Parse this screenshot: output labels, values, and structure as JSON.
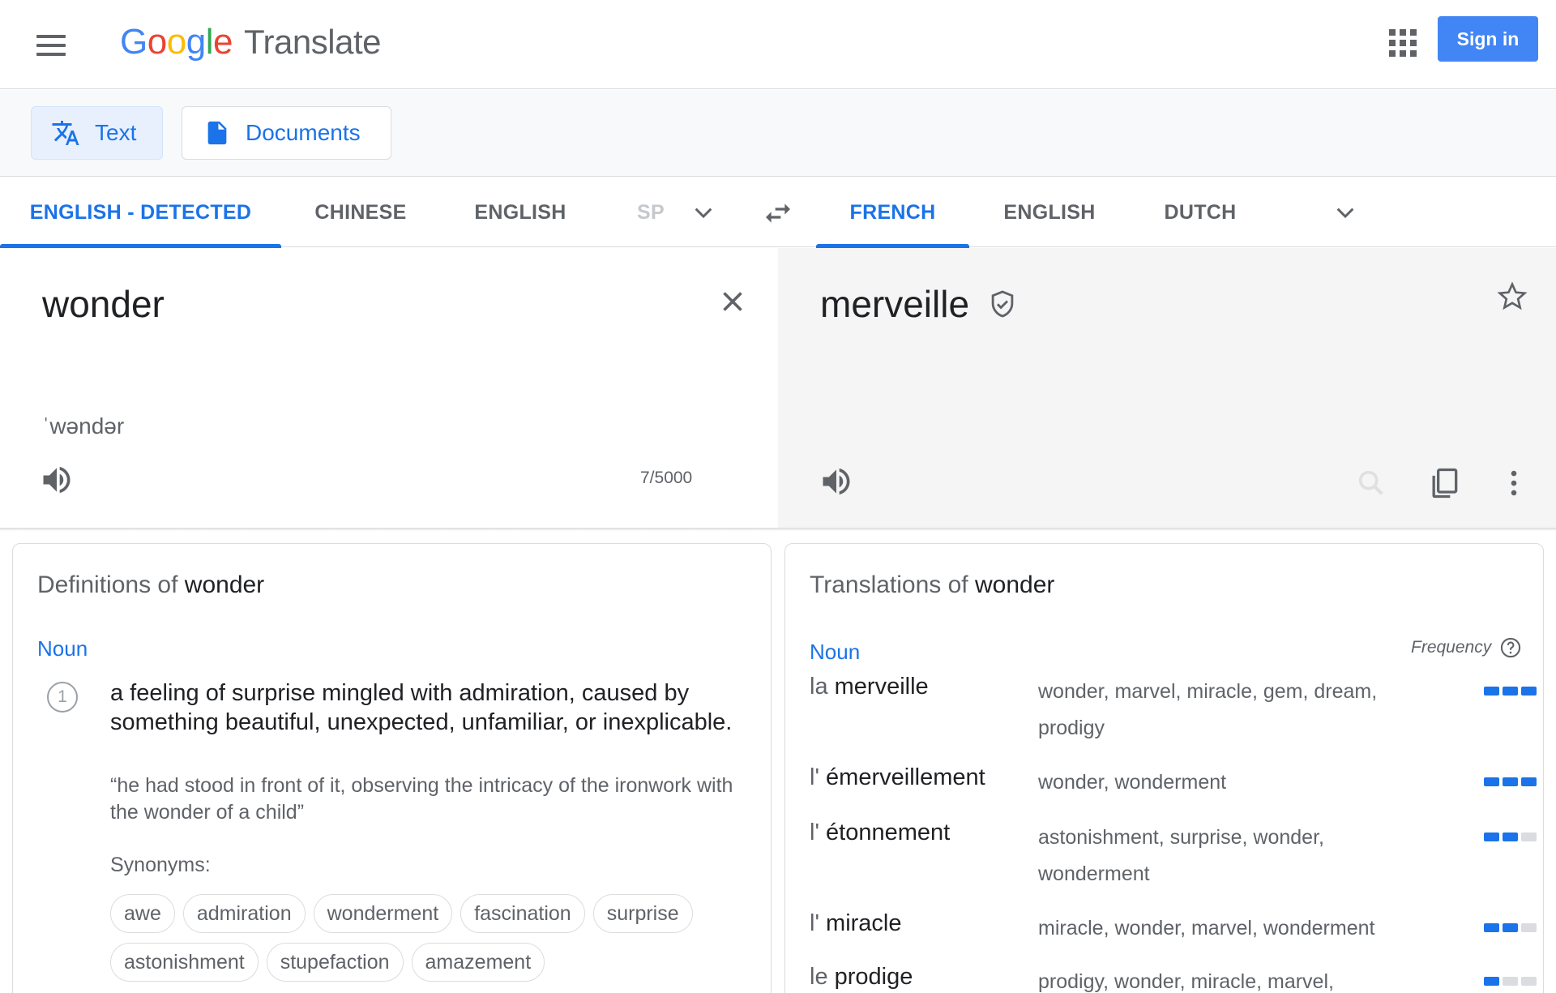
{
  "header": {
    "logo_letters": [
      "G",
      "o",
      "o",
      "g",
      "l",
      "e"
    ],
    "product": "Translate",
    "signin_label": "Sign in"
  },
  "modes": {
    "text_label": "Text",
    "documents_label": "Documents"
  },
  "source_langs": [
    "ENGLISH - DETECTED",
    "CHINESE",
    "ENGLISH",
    "SP"
  ],
  "target_langs": [
    "FRENCH",
    "ENGLISH",
    "DUTCH"
  ],
  "source": {
    "text": "wonder",
    "phonetic": "ˈwəndər",
    "char_count": "7/5000"
  },
  "target": {
    "text": "merveille"
  },
  "definitions": {
    "title_prefix": "Definitions of",
    "word": "wonder",
    "pos": "Noun",
    "number": "1",
    "text": "a feeling of surprise mingled with admiration, caused by something beautiful, unexpected, unfamiliar, or inexplicable.",
    "example": "“he had stood in front of it, observing the intricacy of the ironwork with the wonder of a child”",
    "synonyms_label": "Synonyms:",
    "synonyms_row1": [
      "awe",
      "admiration",
      "wonderment",
      "fascination",
      "surprise"
    ],
    "synonyms_row2": [
      "astonishment",
      "stupefaction",
      "amazement"
    ]
  },
  "translations": {
    "title_prefix": "Translations of",
    "word": "wonder",
    "pos": "Noun",
    "frequency_label": "Frequency",
    "rows": [
      {
        "article": "la",
        "word": "merveille",
        "synonyms": "wonder, marvel, miracle, gem, dream, prodigy",
        "frequency": 3
      },
      {
        "article": "l'",
        "word": "émerveillement",
        "synonyms": "wonder, wonderment",
        "frequency": 3
      },
      {
        "article": "l'",
        "word": "étonnement",
        "synonyms": "astonishment, surprise, wonder, wonderment",
        "frequency": 2
      },
      {
        "article": "l'",
        "word": "miracle",
        "synonyms": "miracle, wonder, marvel, wonderment",
        "frequency": 2
      },
      {
        "article": "le",
        "word": "prodige",
        "synonyms": "prodigy, wonder, miracle, marvel, portent,",
        "frequency": 1
      }
    ]
  },
  "colors": {
    "accent": "#1a73e8",
    "signin_bg": "#4285f4"
  }
}
